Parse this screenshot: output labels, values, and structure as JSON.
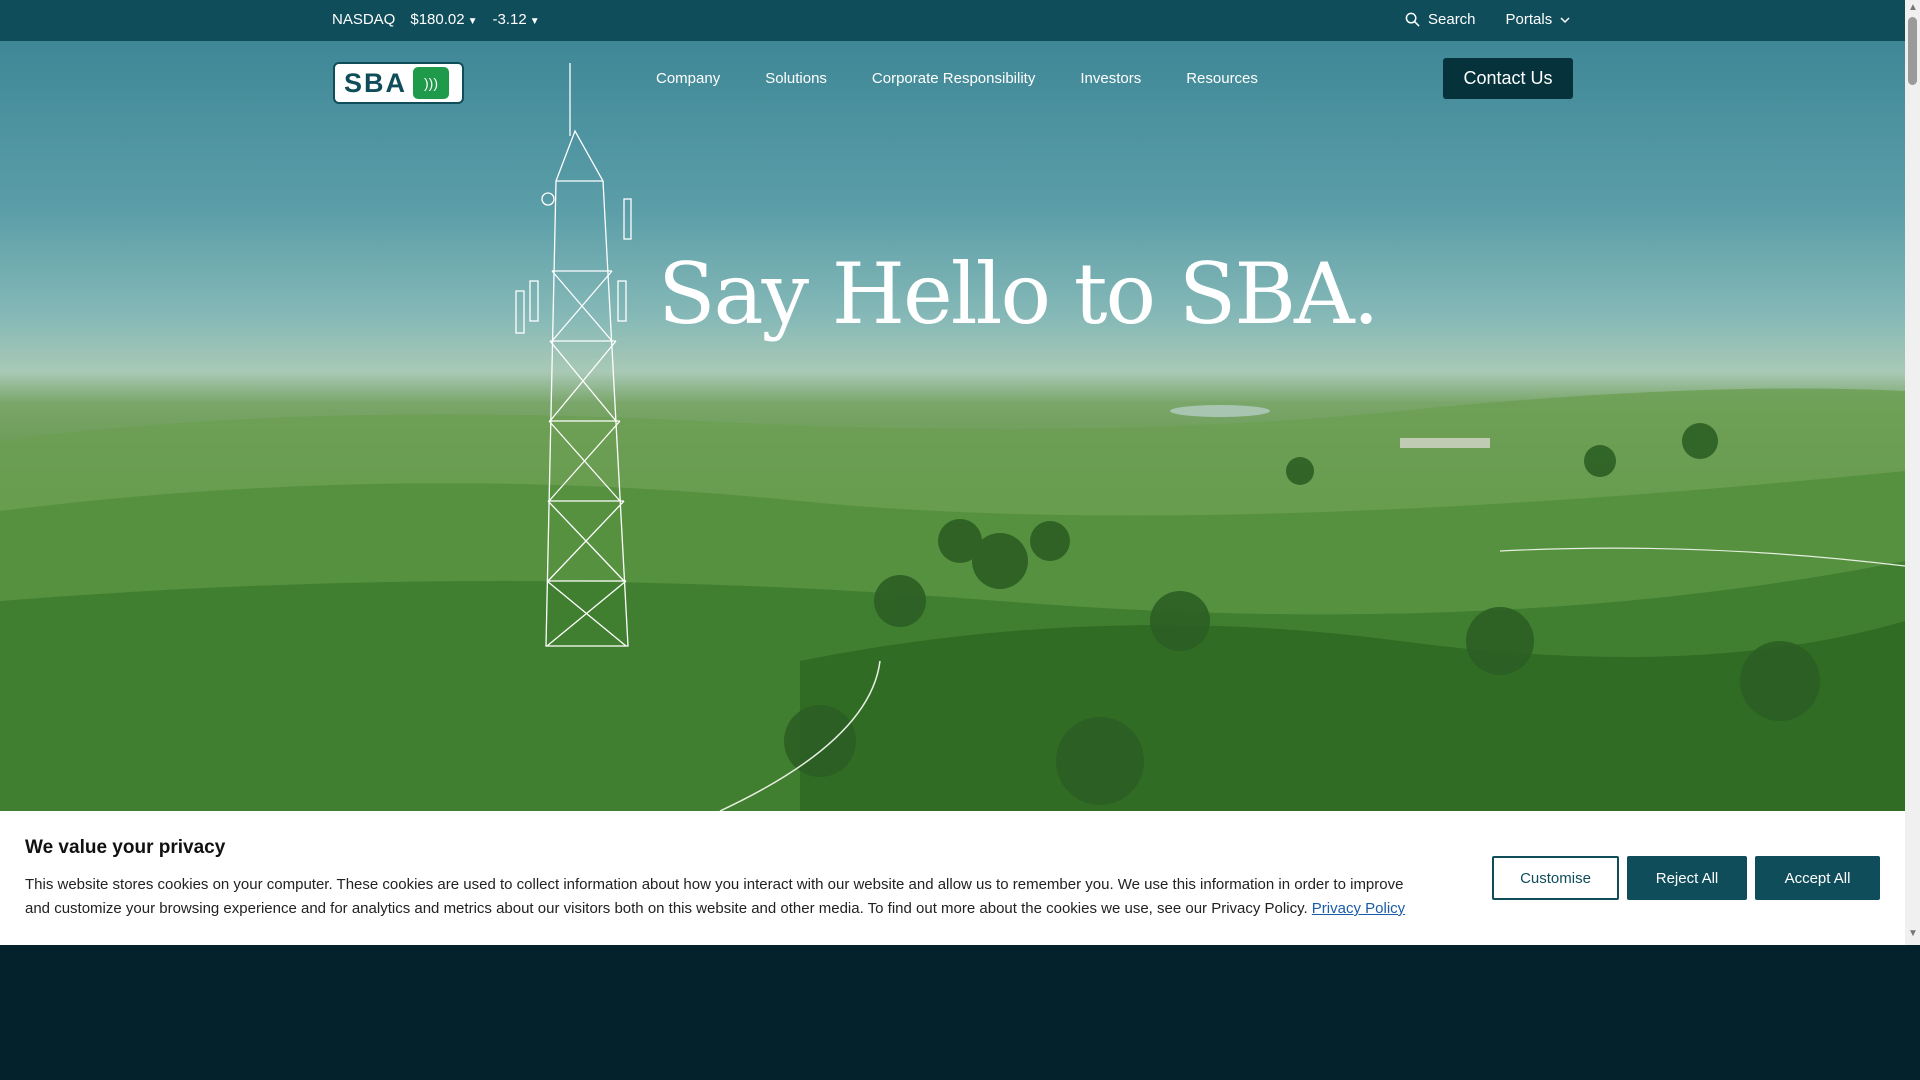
{
  "topbar": {
    "exchange": "NASDAQ",
    "price": "$180.02",
    "change": "-3.12",
    "search_label": "Search",
    "portals_label": "Portals"
  },
  "logo": {
    "text": "SBA"
  },
  "nav": {
    "items": [
      "Company",
      "Solutions",
      "Corporate Responsibility",
      "Investors",
      "Resources"
    ],
    "contact_label": "Contact Us"
  },
  "hero": {
    "headline": "Say Hello to SBA."
  },
  "cookie": {
    "title": "We value your privacy",
    "body": "This website stores cookies on your computer. These cookies are used to collect information about how you interact with our website and allow us to remember you. We use this information in order to improve and customize your browsing experience and for analytics and metrics about our visitors both on this website and other media. To find out more about the cookies we use, see our Privacy Policy.",
    "link": "Privacy Policy",
    "customise": "Customise",
    "reject": "Reject All",
    "accept": "Accept All"
  },
  "colors": {
    "brand_teal": "#0f4d5b",
    "brand_green": "#1e9a4a",
    "dark_footer": "#04222b"
  }
}
